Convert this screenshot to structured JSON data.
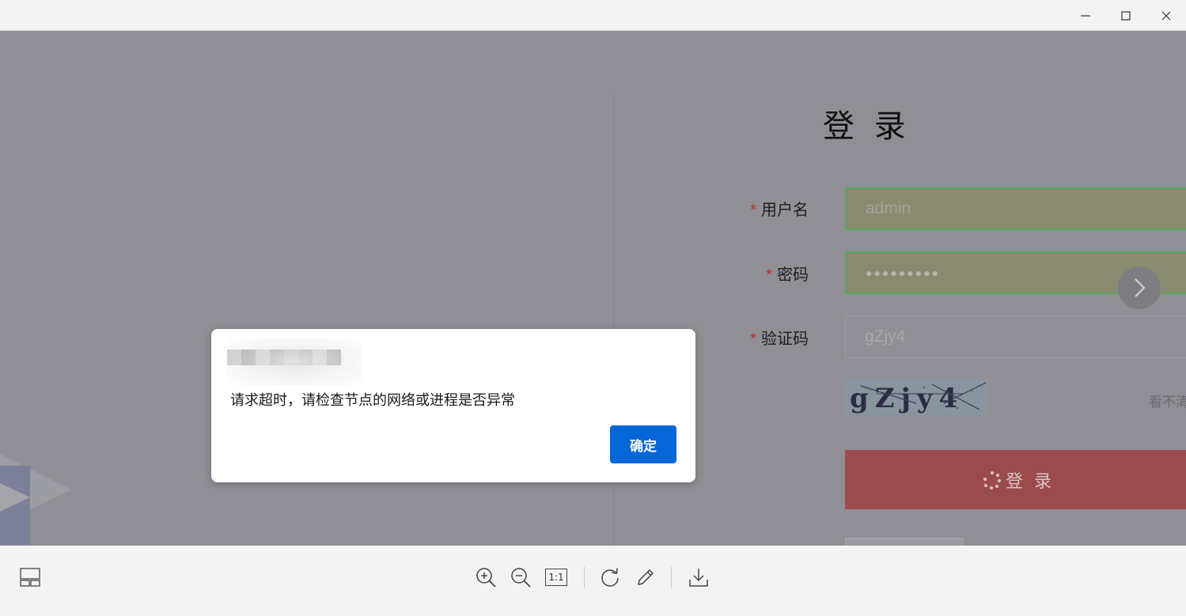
{
  "window": {
    "minimize_icon": "minimize-icon",
    "maximize_icon": "maximize-icon",
    "close_icon": "close-icon"
  },
  "login": {
    "title": "登 录",
    "required_mark": "*",
    "username_label": "用户名",
    "username_value": "admin",
    "password_label": "密码",
    "password_value": "●●●●●●●●●",
    "captcha_label": "验证码",
    "captcha_value": "gZjy4",
    "captcha_image_text": "gZjy4",
    "captcha_refresh_link": "看不清",
    "submit_label": "登 录"
  },
  "dialog": {
    "message": "请求超时，请检查节点的网络或进程是否异常",
    "ok_label": "确定"
  },
  "toolbar": {
    "items": [
      "layout-icon",
      "zoom-in-icon",
      "zoom-out-icon",
      "actual-size-icon",
      "rotate-icon",
      "edit-icon",
      "download-icon"
    ],
    "actual_size_label": "1:1"
  },
  "colors": {
    "overlay": "#8f8f95",
    "primary_button": "#0566d8",
    "login_button": "#9b4a4d",
    "input_border": "#5aa55f",
    "required": "#c1272d"
  }
}
